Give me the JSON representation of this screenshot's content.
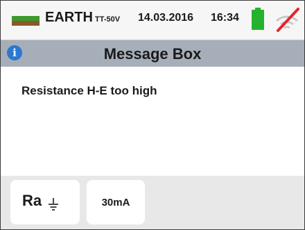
{
  "status_bar": {
    "mode_title": "EARTH",
    "mode_sub": "TT-50V",
    "date": "14.03.2016",
    "time": "16:34",
    "battery_icon": "battery-full-icon",
    "wireless_icon": "wifi-off-icon"
  },
  "title_bar": {
    "icon": "info-icon",
    "info_glyph": "i",
    "title": "Message Box"
  },
  "message": {
    "text": "Resistance H-E too high"
  },
  "bottom_bar": {
    "params": [
      {
        "label": "Ra",
        "icon": "ground-icon"
      },
      {
        "label": "30mA"
      }
    ]
  },
  "colors": {
    "title_bar_bg": "#a6afb9",
    "info_icon": "#2b78d0",
    "battery": "#25b22f",
    "wifi_slash": "#e3262b",
    "bottom_bar_bg": "#e8e8e8"
  }
}
